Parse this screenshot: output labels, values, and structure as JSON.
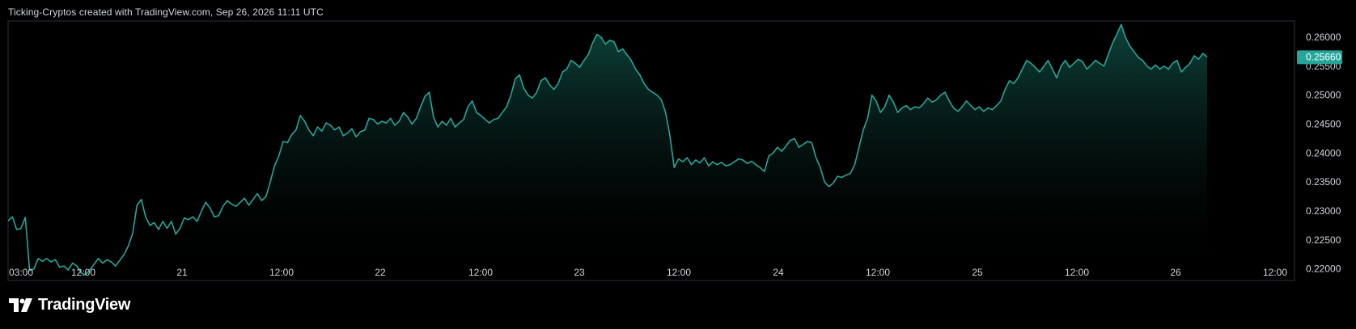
{
  "header": {
    "caption": "Ticking-Cryptos created with TradingView.com, Sep 26, 2026 11:11 UTC"
  },
  "branding": {
    "logo_text": "TradingView",
    "logo_icon": "tradingview-logo-icon"
  },
  "colors": {
    "background": "#000000",
    "line": "#26a69a",
    "area_top": "#0f4a40",
    "price_badge": "#26a69a",
    "text": "#d1d4dc",
    "border": "#2a2e39"
  },
  "chart_data": {
    "type": "area",
    "title": "",
    "xlabel": "",
    "ylabel": "",
    "ylim": [
      0.218,
      0.2628
    ],
    "grid": false,
    "x_ticks": [
      "03:00",
      "12:00",
      "21",
      "12:00",
      "22",
      "12:00",
      "23",
      "12:00",
      "24",
      "12:00",
      "25",
      "12:00",
      "26",
      "12:00"
    ],
    "y_ticks": [
      "0.22000",
      "0.22500",
      "0.23000",
      "0.23500",
      "0.24000",
      "0.24500",
      "0.25000",
      "0.25500",
      "0.26000"
    ],
    "last_price": "0.25660",
    "x_unit": "hours since 20 03:00",
    "series": [
      {
        "name": "",
        "points": [
          [
            0,
            0.2283
          ],
          [
            1,
            0.229
          ],
          [
            2,
            0.2268
          ],
          [
            3,
            0.227
          ],
          [
            4,
            0.2289
          ],
          [
            4.5,
            0.2245
          ],
          [
            5,
            0.2197
          ],
          [
            6,
            0.22
          ],
          [
            7,
            0.2218
          ],
          [
            8,
            0.2213
          ],
          [
            9,
            0.2218
          ],
          [
            10,
            0.2212
          ],
          [
            11,
            0.2216
          ],
          [
            12,
            0.2203
          ],
          [
            13,
            0.2205
          ],
          [
            14,
            0.2198
          ],
          [
            15,
            0.221
          ],
          [
            16,
            0.2205
          ],
          [
            17,
            0.2193
          ],
          [
            18,
            0.219
          ],
          [
            19,
            0.2198
          ],
          [
            20,
            0.2208
          ],
          [
            21,
            0.2218
          ],
          [
            22,
            0.221
          ],
          [
            23,
            0.2216
          ],
          [
            24,
            0.2212
          ],
          [
            25,
            0.2205
          ],
          [
            26,
            0.2215
          ],
          [
            27,
            0.2225
          ],
          [
            28,
            0.224
          ],
          [
            29,
            0.2262
          ],
          [
            30,
            0.231
          ],
          [
            31,
            0.232
          ],
          [
            32,
            0.229
          ],
          [
            33,
            0.2275
          ],
          [
            34,
            0.228
          ],
          [
            35,
            0.2268
          ],
          [
            36,
            0.2282
          ],
          [
            37,
            0.227
          ],
          [
            38,
            0.2282
          ],
          [
            39,
            0.226
          ],
          [
            40,
            0.227
          ],
          [
            41,
            0.2288
          ],
          [
            42,
            0.2285
          ],
          [
            43,
            0.229
          ],
          [
            44,
            0.2282
          ],
          [
            45,
            0.23
          ],
          [
            46,
            0.2315
          ],
          [
            47,
            0.2305
          ],
          [
            48,
            0.229
          ],
          [
            49,
            0.2292
          ],
          [
            50,
            0.2308
          ],
          [
            51,
            0.2318
          ],
          [
            52,
            0.2312
          ],
          [
            53,
            0.2308
          ],
          [
            54,
            0.2315
          ],
          [
            55,
            0.2322
          ],
          [
            56,
            0.231
          ],
          [
            57,
            0.232
          ],
          [
            58,
            0.233
          ],
          [
            59,
            0.2318
          ],
          [
            60,
            0.2325
          ],
          [
            61,
            0.235
          ],
          [
            62,
            0.2378
          ],
          [
            63,
            0.2395
          ],
          [
            64,
            0.242
          ],
          [
            65,
            0.2418
          ],
          [
            66,
            0.2432
          ],
          [
            67,
            0.244
          ],
          [
            68,
            0.2465
          ],
          [
            69,
            0.2455
          ],
          [
            70,
            0.244
          ],
          [
            71,
            0.243
          ],
          [
            72,
            0.2445
          ],
          [
            73,
            0.2438
          ],
          [
            74,
            0.2452
          ],
          [
            75,
            0.2448
          ],
          [
            76,
            0.244
          ],
          [
            77,
            0.2445
          ],
          [
            78,
            0.243
          ],
          [
            79,
            0.2435
          ],
          [
            80,
            0.2442
          ],
          [
            81,
            0.2428
          ],
          [
            82,
            0.2437
          ],
          [
            83,
            0.244
          ],
          [
            84,
            0.246
          ],
          [
            85,
            0.2458
          ],
          [
            86,
            0.245
          ],
          [
            87,
            0.2455
          ],
          [
            88,
            0.2452
          ],
          [
            89,
            0.246
          ],
          [
            90,
            0.2448
          ],
          [
            91,
            0.2455
          ],
          [
            92,
            0.247
          ],
          [
            93,
            0.2462
          ],
          [
            94,
            0.245
          ],
          [
            95,
            0.246
          ],
          [
            96,
            0.248
          ],
          [
            97,
            0.2498
          ],
          [
            98,
            0.2505
          ],
          [
            99,
            0.2462
          ],
          [
            100,
            0.2445
          ],
          [
            101,
            0.2455
          ],
          [
            102,
            0.2448
          ],
          [
            103,
            0.246
          ],
          [
            104,
            0.2445
          ],
          [
            105,
            0.2452
          ],
          [
            106,
            0.2458
          ],
          [
            107,
            0.248
          ],
          [
            108,
            0.249
          ],
          [
            109,
            0.247
          ],
          [
            110,
            0.2465
          ],
          [
            111,
            0.2458
          ],
          [
            112,
            0.2452
          ],
          [
            113,
            0.2458
          ],
          [
            114,
            0.246
          ],
          [
            115,
            0.247
          ],
          [
            116,
            0.248
          ],
          [
            117,
            0.25
          ],
          [
            118,
            0.2528
          ],
          [
            119,
            0.2535
          ],
          [
            120,
            0.2512
          ],
          [
            121,
            0.25
          ],
          [
            122,
            0.2495
          ],
          [
            123,
            0.2505
          ],
          [
            124,
            0.2525
          ],
          [
            125,
            0.253
          ],
          [
            126,
            0.2518
          ],
          [
            127,
            0.251
          ],
          [
            128,
            0.252
          ],
          [
            129,
            0.254
          ],
          [
            130,
            0.2545
          ],
          [
            131,
            0.256
          ],
          [
            132,
            0.2555
          ],
          [
            133,
            0.2548
          ],
          [
            134,
            0.256
          ],
          [
            135,
            0.257
          ],
          [
            136,
            0.259
          ],
          [
            137,
            0.2605
          ],
          [
            138,
            0.26
          ],
          [
            139,
            0.2588
          ],
          [
            140,
            0.2595
          ],
          [
            141,
            0.2592
          ],
          [
            142,
            0.2575
          ],
          [
            143,
            0.258
          ],
          [
            144,
            0.257
          ],
          [
            145,
            0.256
          ],
          [
            146,
            0.2545
          ],
          [
            147,
            0.2535
          ],
          [
            148,
            0.252
          ],
          [
            149,
            0.251
          ],
          [
            150,
            0.2505
          ],
          [
            151,
            0.25
          ],
          [
            152,
            0.2492
          ],
          [
            153,
            0.247
          ],
          [
            154,
            0.243
          ],
          [
            155,
            0.2375
          ],
          [
            156,
            0.239
          ],
          [
            157,
            0.2385
          ],
          [
            158,
            0.2392
          ],
          [
            159,
            0.238
          ],
          [
            160,
            0.2388
          ],
          [
            161,
            0.2383
          ],
          [
            162,
            0.2392
          ],
          [
            163,
            0.2378
          ],
          [
            164,
            0.2385
          ],
          [
            165,
            0.238
          ],
          [
            166,
            0.2384
          ],
          [
            167,
            0.2378
          ],
          [
            168,
            0.238
          ],
          [
            169,
            0.2385
          ],
          [
            170,
            0.239
          ],
          [
            171,
            0.2388
          ],
          [
            172,
            0.2382
          ],
          [
            173,
            0.2386
          ],
          [
            174,
            0.238
          ],
          [
            175,
            0.2375
          ],
          [
            176,
            0.2368
          ],
          [
            177,
            0.2395
          ],
          [
            178,
            0.24
          ],
          [
            179,
            0.241
          ],
          [
            180,
            0.2403
          ],
          [
            181,
            0.2412
          ],
          [
            182,
            0.2422
          ],
          [
            183,
            0.2425
          ],
          [
            184,
            0.241
          ],
          [
            185,
            0.2415
          ],
          [
            186,
            0.242
          ],
          [
            187,
            0.2418
          ],
          [
            188,
            0.2392
          ],
          [
            189,
            0.2375
          ],
          [
            190,
            0.235
          ],
          [
            191,
            0.2342
          ],
          [
            192,
            0.2348
          ],
          [
            193,
            0.236
          ],
          [
            194,
            0.2358
          ],
          [
            195,
            0.2362
          ],
          [
            196,
            0.2365
          ],
          [
            197,
            0.238
          ],
          [
            198,
            0.241
          ],
          [
            199,
            0.244
          ],
          [
            200,
            0.246
          ],
          [
            201,
            0.25
          ],
          [
            202,
            0.249
          ],
          [
            203,
            0.247
          ],
          [
            204,
            0.248
          ],
          [
            205,
            0.25
          ],
          [
            206,
            0.2488
          ],
          [
            207,
            0.247
          ],
          [
            208,
            0.2478
          ],
          [
            209,
            0.2482
          ],
          [
            210,
            0.2475
          ],
          [
            211,
            0.248
          ],
          [
            212,
            0.2478
          ],
          [
            213,
            0.2485
          ],
          [
            214,
            0.2495
          ],
          [
            215,
            0.2488
          ],
          [
            216,
            0.2492
          ],
          [
            217,
            0.25
          ],
          [
            218,
            0.2505
          ],
          [
            219,
            0.249
          ],
          [
            220,
            0.2478
          ],
          [
            221,
            0.2472
          ],
          [
            222,
            0.248
          ],
          [
            223,
            0.249
          ],
          [
            224,
            0.2482
          ],
          [
            225,
            0.2475
          ],
          [
            226,
            0.248
          ],
          [
            227,
            0.2472
          ],
          [
            228,
            0.2478
          ],
          [
            229,
            0.2475
          ],
          [
            230,
            0.2482
          ],
          [
            231,
            0.249
          ],
          [
            232,
            0.251
          ],
          [
            233,
            0.2525
          ],
          [
            234,
            0.252
          ],
          [
            235,
            0.253
          ],
          [
            236,
            0.2545
          ],
          [
            237,
            0.256
          ],
          [
            238,
            0.2555
          ],
          [
            239,
            0.2548
          ],
          [
            240,
            0.254
          ],
          [
            241,
            0.255
          ],
          [
            242,
            0.256
          ],
          [
            243,
            0.2545
          ],
          [
            244,
            0.253
          ],
          [
            245,
            0.255
          ],
          [
            246,
            0.256
          ],
          [
            247,
            0.2548
          ],
          [
            248,
            0.2555
          ],
          [
            249,
            0.2562
          ],
          [
            250,
            0.2558
          ],
          [
            251,
            0.2545
          ],
          [
            252,
            0.2552
          ],
          [
            253,
            0.256
          ],
          [
            254,
            0.2555
          ],
          [
            255,
            0.255
          ],
          [
            256,
            0.257
          ],
          [
            257,
            0.259
          ],
          [
            258,
            0.2605
          ],
          [
            259,
            0.2622
          ],
          [
            260,
            0.26
          ],
          [
            261,
            0.2585
          ],
          [
            262,
            0.2575
          ],
          [
            263,
            0.2565
          ],
          [
            264,
            0.256
          ],
          [
            265,
            0.255
          ],
          [
            266,
            0.2545
          ],
          [
            267,
            0.2552
          ],
          [
            268,
            0.2545
          ],
          [
            269,
            0.255
          ],
          [
            270,
            0.2545
          ],
          [
            271,
            0.2555
          ],
          [
            272,
            0.256
          ],
          [
            273,
            0.254
          ],
          [
            274,
            0.2548
          ],
          [
            275,
            0.2555
          ],
          [
            276,
            0.2568
          ],
          [
            277,
            0.2562
          ],
          [
            278,
            0.2572
          ],
          [
            279,
            0.2566
          ]
        ]
      }
    ]
  }
}
